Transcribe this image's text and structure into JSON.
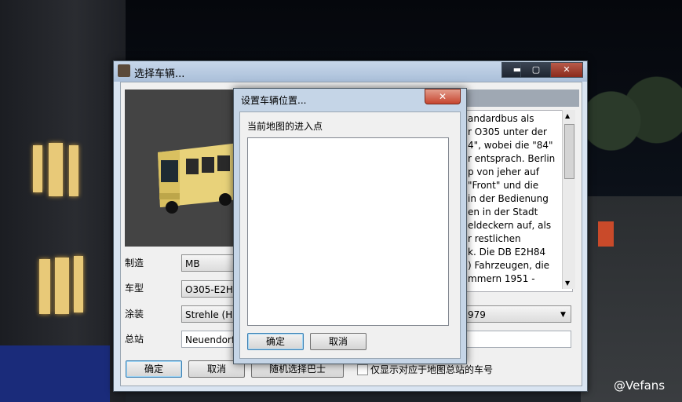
{
  "main_window": {
    "title": "选择车辆...",
    "min_glyph": "▬",
    "max_glyph": "▢",
    "close_glyph": "✕",
    "description_text": "andardbus als\nr O305 unter der\n4\", wobei die \"84\"\nr entsprach. Berlin\np von jeher auf\n\"Front\" und die\nin der Bedienung\nen in der Stadt\neldeckern auf, als\nr restlichen\nk. Die DB E2H84\n) Fahrzeugen, die\nmmern 1951 -",
    "labels": {
      "manufacturer": "制造",
      "model": "车型",
      "livery": "涂装",
      "depot": "总站"
    },
    "values": {
      "manufacturer": "MB",
      "model": "O305-E2H",
      "livery": "Strehle (H)",
      "livery_year": "979",
      "depot": "Neuendorf"
    },
    "buttons": {
      "ok": "确定",
      "cancel": "取消",
      "random": "随机选择巴士"
    },
    "checkbox_label": "仅显示对应于地图总站的车号"
  },
  "dialog": {
    "title": "设置车辆位置...",
    "close_glyph": "✕",
    "list_label": "当前地图的进入点",
    "entries": [],
    "buttons": {
      "ok": "确定",
      "cancel": "取消"
    }
  },
  "watermark": "@Vefans"
}
